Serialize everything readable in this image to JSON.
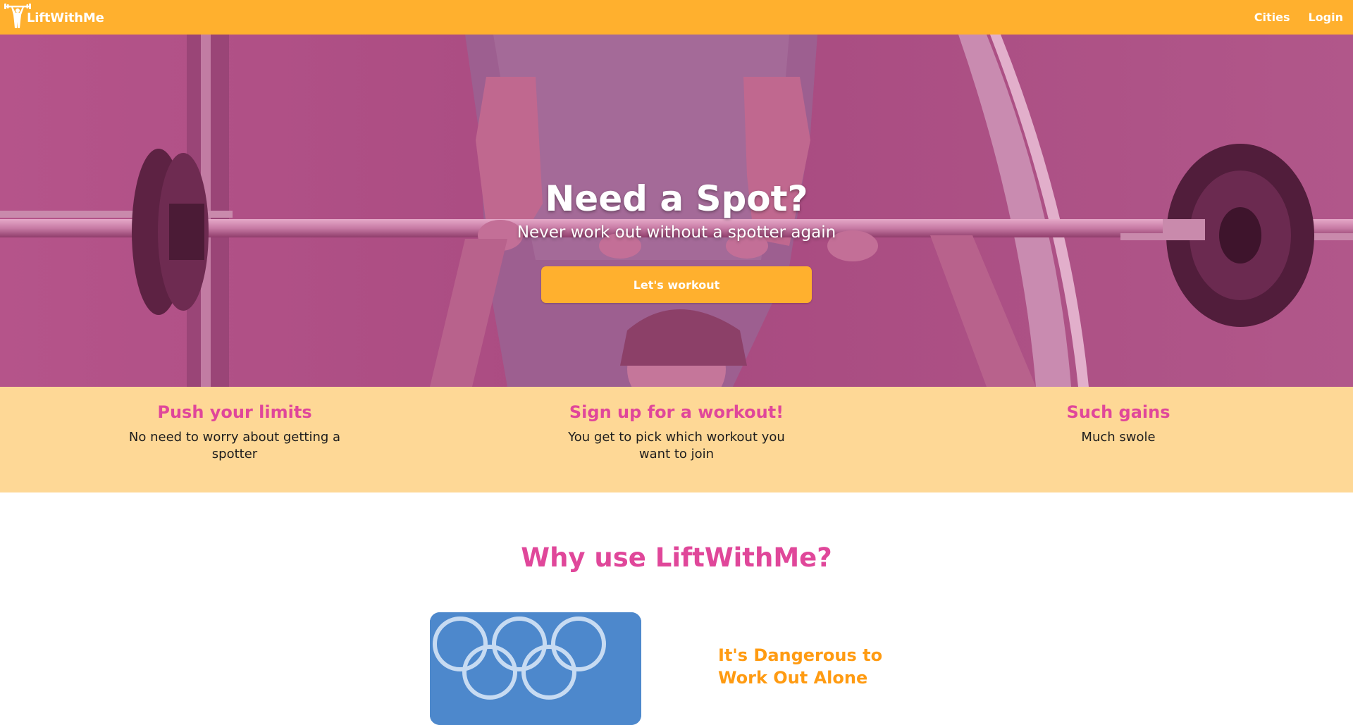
{
  "brand": {
    "name": "LiftWithMe"
  },
  "nav": {
    "cities": "Cities",
    "login": "Login"
  },
  "hero": {
    "title": "Need a Spot?",
    "subtitle": "Never work out without a spotter again",
    "cta": "Let's workout"
  },
  "features": [
    {
      "title": "Push your limits",
      "text": "No need to worry about getting a spotter"
    },
    {
      "title": "Sign up for a workout!",
      "text": "You get to pick which workout you want to join"
    },
    {
      "title": "Such gains",
      "text": "Much swole"
    }
  ],
  "why": {
    "title": "Why use LiftWithMe?",
    "card_title": "It's Dangerous to Work Out Alone"
  },
  "colors": {
    "primary": "#ffb02e",
    "accent_pink": "#e0479a",
    "feature_bg": "#fed896",
    "hero_overlay": "#a64079",
    "orange_heading": "#ff9b12"
  },
  "icons": {
    "brand_logo": "weightlifter-icon"
  }
}
